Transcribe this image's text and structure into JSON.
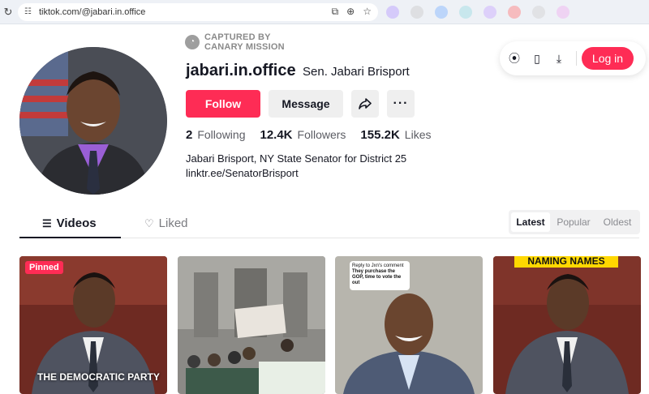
{
  "browser": {
    "url": "tiktok.com/@jabari.in.office",
    "extension_colors": [
      "#b59bff",
      "#c9c9c9",
      "#7fb3ff",
      "#9adbe3",
      "#c8a8ff",
      "#ff7a7a",
      "#d0d0d0",
      "#f0b0f0"
    ]
  },
  "badge": {
    "line1": "CAPTURED BY",
    "line2": "CANARY MISSION"
  },
  "header_actions": {
    "login_label": "Log in"
  },
  "profile": {
    "username": "jabari.in.office",
    "nickname": "Sen. Jabari Brisport",
    "follow_label": "Follow",
    "message_label": "Message",
    "more_label": "···",
    "stats": {
      "following_count": "2",
      "following_label": "Following",
      "followers_count": "12.4K",
      "followers_label": "Followers",
      "likes_count": "155.2K",
      "likes_label": "Likes"
    },
    "bio": "Jabari Brisport, NY State Senator for District 25",
    "link": "linktr.ee/SenatorBrisport"
  },
  "tabs": {
    "videos": "Videos",
    "liked": "Liked"
  },
  "sort": {
    "latest": "Latest",
    "popular": "Popular",
    "oldest": "Oldest"
  },
  "videos": [
    {
      "badge": "Pinned",
      "caption": "THE DEMOCRATIC PARTY"
    },
    {
      "caption": ""
    },
    {
      "bubble_top": "Reply to Jxn's comment",
      "bubble_main": "They purchase the GOP, time to vote the out"
    },
    {
      "banner": "NAMING NAMES"
    }
  ],
  "colors": {
    "accent": "#fe2c55",
    "text": "#161823",
    "muted": "#5b5c63"
  }
}
